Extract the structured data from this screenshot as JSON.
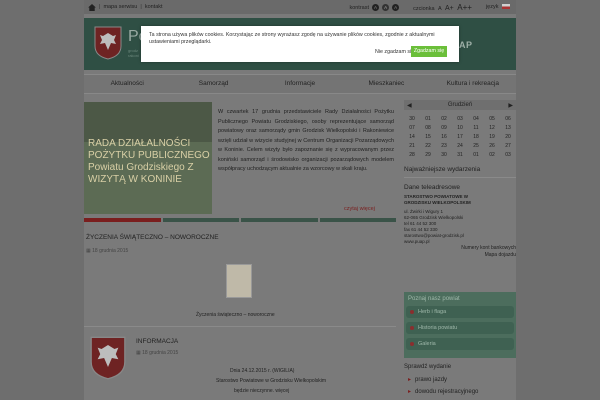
{
  "topbar": {
    "links": [
      "mapa serwisu",
      "kontakt"
    ],
    "contrast_label": "kontrast",
    "contrast_buttons": [
      "A",
      "A",
      "A"
    ],
    "font_label": "czcionka",
    "font_sizes": [
      "A",
      "A+",
      "A++"
    ],
    "lang_label": "język"
  },
  "header": {
    "title": "Po",
    "subtitle_lines": [
      "grodz",
      "rakoni"
    ],
    "epuap": "ePUAP"
  },
  "nav": [
    "Aktualności",
    "Samorząd",
    "Informacje",
    "Mieszkaniec",
    "Kultura i rekreacja"
  ],
  "slider": {
    "caption": "RADA DZIAŁALNOŚCI POŻYTKU PUBLICZNEGO Powiatu Grodziskiego Z WIZYTĄ W KONINIE",
    "text": "W czwartek 17 grudnia przedstawiciele Rady Działalności Pożytku Publicznego Powiatu Grodziskiego, osoby reprezentujące samorząd powiatowy oraz samorządy gmin Grodzisk Wielkopolski i Rakoniewice wzięli udział w wizycie studyjnej w Centrum Organizacji Pozarządowych w Koninie. Celem wizyty było zapoznanie się z wypracowanym przez koniński samorząd i środowisko organizacji pozarządowych modelem współpracy uchodzącym aktualnie za wzorcowy w skali kraju.",
    "more": "czytaj więcej",
    "bars": 4,
    "active_bar": 0
  },
  "news": [
    {
      "title": "ŻYCZENIA ŚWIĄTECZNO – NOWOROCZNE",
      "date": "18 grudnia 2015",
      "caption": "Życzenia świąteczno – noworoczne"
    },
    {
      "title": "INFORMACJA",
      "date": "18 grudnia 2015",
      "line1": "Dnia 24.12.2015 r. (WIGILIA)",
      "line2": "Starostwo Powiatowe w Grodzisku Wielkopolskim",
      "line3": "będzie nieczynne. więcej"
    }
  ],
  "calendar": {
    "month": "Grudzień",
    "prev": "◀",
    "next": "▶",
    "days": [
      "30",
      "01",
      "02",
      "03",
      "04",
      "05",
      "06",
      "07",
      "08",
      "09",
      "10",
      "11",
      "12",
      "13",
      "14",
      "15",
      "16",
      "17",
      "18",
      "19",
      "20",
      "21",
      "22",
      "23",
      "24",
      "25",
      "26",
      "27",
      "28",
      "29",
      "30",
      "31",
      "01",
      "02",
      "03"
    ]
  },
  "right": {
    "latest": "Najważniejsze wydarzenia",
    "contact_h": "Dane teleadresowe",
    "org1": "STAROSTWO POWIATOWE W",
    "org2": "GRODZISKU WIELKOPOLSKIM",
    "street": "ul. Żwirki i Wigury 1",
    "city": "62-065 Grodzisk Wielkopolski",
    "tel": "tel 61 44 52 300",
    "fax": "fax 61 44 52 330",
    "email": "starostwo@powiat-grodzisk.pl",
    "www": "www.puap.pl",
    "bank": "Numery kont bankowych",
    "map": "Mapa dojazdu",
    "know_h": "Poznaj nasz powiat",
    "know_items": [
      "Herb i flaga",
      "Historia powiatu",
      "Galeria"
    ],
    "check_h": "Sprawdź wydanie",
    "check_items": [
      "prawo jazdy",
      "dowodu rejestracyjnego"
    ]
  },
  "cookie": {
    "text": "Ta strona używa plików cookies. Korzystając ze strony wyrażasz zgodę na używanie plików cookies, zgodnie z aktualnymi ustawieniami przeglądarki.",
    "decline": "Nie zgadzam się",
    "accept": "Zgadzam się"
  },
  "colors": {
    "header_green": "#2f4f44",
    "accent_red": "#7a1e1e",
    "accept_green": "#6bbf3a"
  }
}
